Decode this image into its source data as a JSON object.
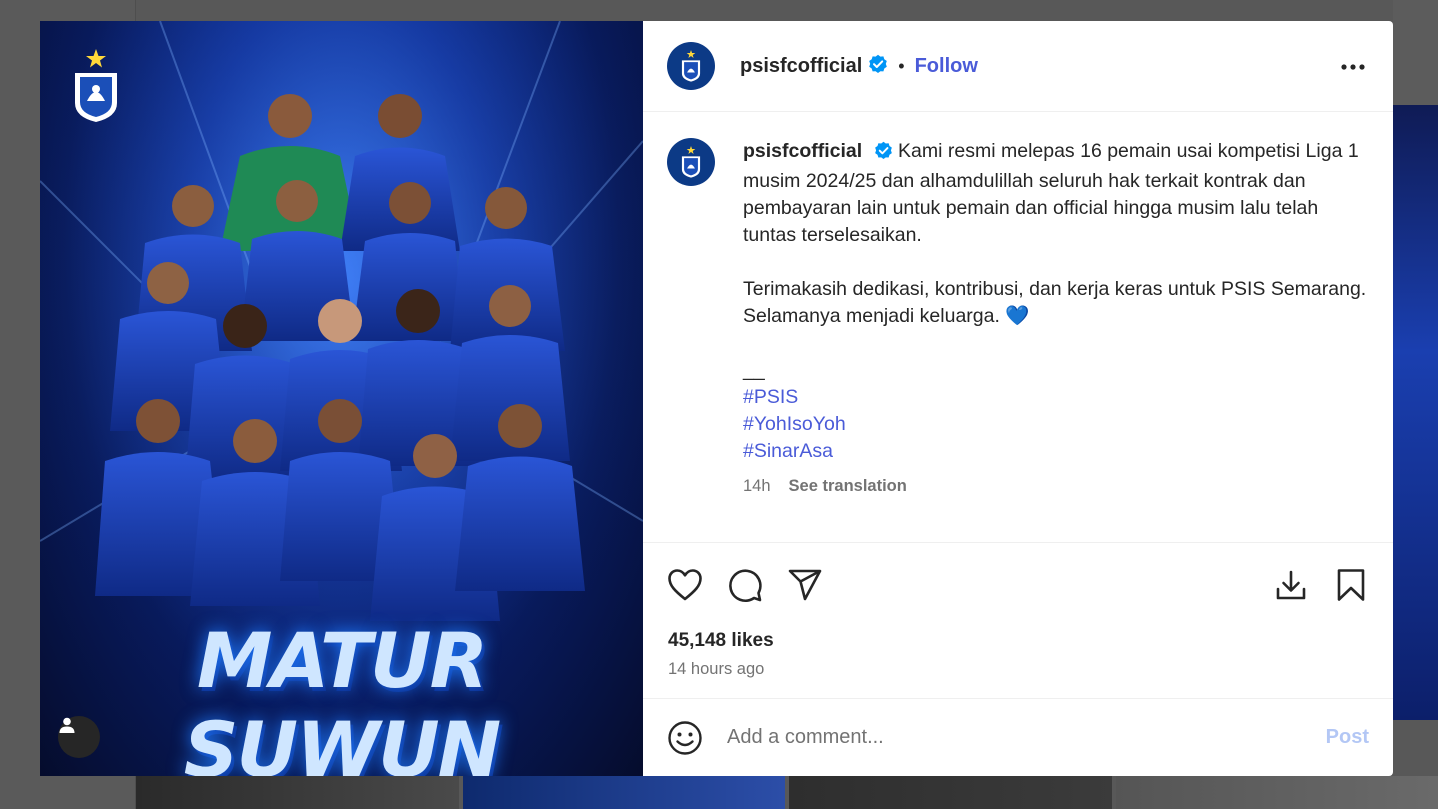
{
  "post": {
    "username": "psisfcofficial",
    "follow_label": "Follow",
    "dot": "•",
    "poster_title": "MATUR SUWUN",
    "caption": {
      "paragraph1": "Kami resmi melepas 16 pemain usai kompetisi Liga 1 musim 2024/25 dan alhamdulillah seluruh hak terkait kontrak dan pembayaran lain untuk pemain dan official hingga musim lalu telah tuntas terselesaikan.",
      "paragraph2": "Terimakasih dedikasi, kontribusi, dan kerja keras untuk PSIS Semarang. Selamanya menjadi keluarga. 💙",
      "separator": "__",
      "hashtags": [
        "#PSIS",
        "#YohIsoYoh",
        "#SinarAsa"
      ]
    },
    "time_ago_short": "14h",
    "see_translation_label": "See translation",
    "likes": "45,148 likes",
    "timestamp": "14 hours ago",
    "comment_placeholder": "Add a comment...",
    "post_label": "Post"
  },
  "icons": {
    "header": [
      "verified-badge-icon",
      "more-options-icon"
    ],
    "actions": [
      "heart-icon",
      "comment-icon",
      "share-icon",
      "download-icon",
      "bookmark-icon"
    ],
    "media": [
      "club-crest-icon",
      "user-tag-icon"
    ],
    "comment": [
      "emoji-icon"
    ]
  },
  "colors": {
    "link_blue": "#4a5bd8",
    "post_disabled": "#b3c7f5",
    "verified": "#0095f6",
    "club_navy": "#0c3a86"
  }
}
